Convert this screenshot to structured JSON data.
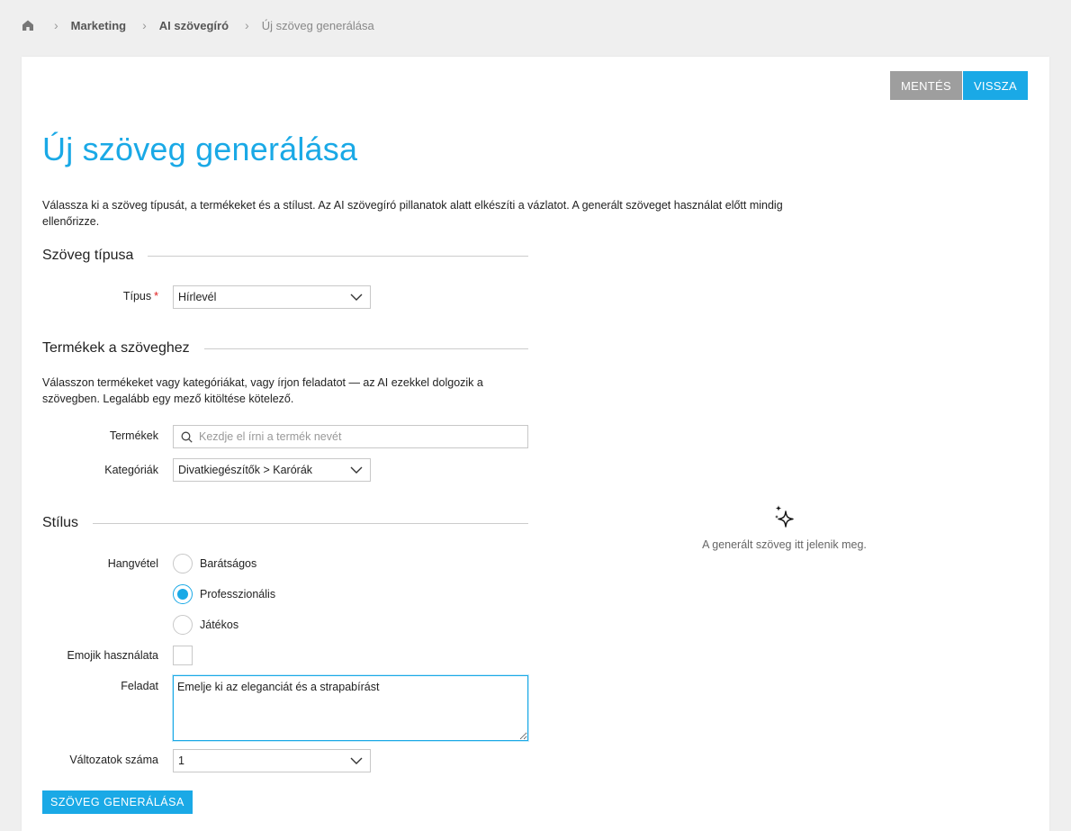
{
  "breadcrumb": {
    "home_icon": "home-icon",
    "items": [
      "Marketing",
      "AI szövegíró",
      "Új szöveg generálása"
    ]
  },
  "toolbar": {
    "save_label": "MENTÉS",
    "back_label": "VISSZA"
  },
  "page": {
    "title": "Új szöveg generálása",
    "intro": "Válassza ki a szöveg típusát, a termékeket és a stílust. Az AI szövegíró pillanatok alatt elkészíti a vázlatot. A generált szöveget használat előtt mindig ellenőrizze."
  },
  "text_type": {
    "heading": "Szöveg típusa",
    "type_label": "Típus",
    "required_mark": "*",
    "type_value": "Hírlevél"
  },
  "products": {
    "heading": "Termékek a szöveghez",
    "intro": "Válasszon termékeket vagy kategóriákat, vagy írjon feladatot — az AI ezekkel dolgozik a szövegben. Legalább egy mező kitöltése kötelező.",
    "products_label": "Termékek",
    "products_placeholder": "Kezdje el írni a termék nevét",
    "categories_label": "Kategóriák",
    "categories_value": "Divatkiegészítők > Karórák"
  },
  "style": {
    "heading": "Stílus",
    "tone_label": "Hangvétel",
    "tone_options": [
      "Barátságos",
      "Professzionális",
      "Játékos"
    ],
    "tone_selected": "Professzionális",
    "emoji_label": "Emojik használata",
    "emoji_checked": false,
    "task_label": "Feladat",
    "task_value": "Emelje ki az eleganciát és a strapabírást",
    "variants_label": "Változatok száma",
    "variants_value": "1"
  },
  "generate_label": "SZÖVEG GENERÁLÁSA",
  "result_panel": {
    "icon": "sparkle-icon",
    "placeholder": "A generált szöveg itt jelenik meg."
  },
  "colors": {
    "accent": "#1aa9e6",
    "grey_button": "#9e9e9e",
    "required": "#e02020"
  }
}
